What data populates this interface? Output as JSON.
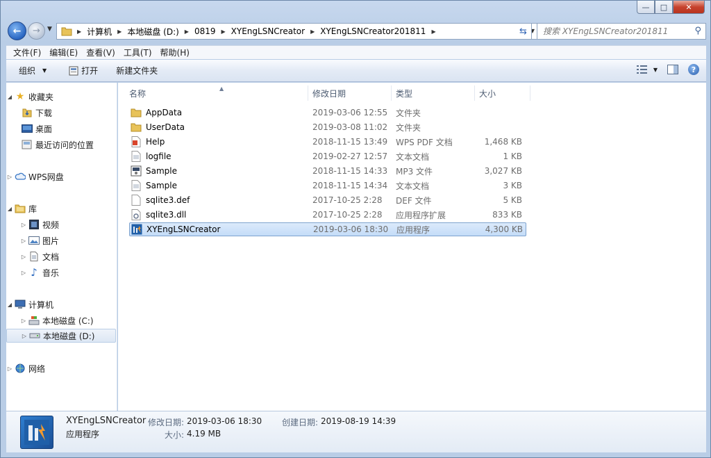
{
  "window": {
    "caption_buttons": {
      "minimize": "—",
      "maximize": "□",
      "close": "✕"
    }
  },
  "address": {
    "crumbs": [
      "计算机",
      "本地磁盘 (D:)",
      "0819",
      "XYEngLSNCreator",
      "XYEngLSNCreator201811"
    ]
  },
  "search": {
    "placeholder": "搜索 XYEngLSNCreator201811"
  },
  "menu": [
    "文件(F)",
    "编辑(E)",
    "查看(V)",
    "工具(T)",
    "帮助(H)"
  ],
  "toolbar": {
    "organize": "组织",
    "open": "打开",
    "new_folder": "新建文件夹"
  },
  "navpane": {
    "favorites": "收藏夹",
    "downloads": "下载",
    "desktop": "桌面",
    "recent": "最近访问的位置",
    "wps": "WPS网盘",
    "libraries": "库",
    "videos": "视频",
    "pictures": "图片",
    "documents": "文档",
    "music": "音乐",
    "computer": "计算机",
    "drive_c": "本地磁盘 (C:)",
    "drive_d": "本地磁盘 (D:)",
    "network": "网络"
  },
  "columns": {
    "name": "名称",
    "date": "修改日期",
    "type": "类型",
    "size": "大小"
  },
  "files": [
    {
      "name": "AppData",
      "date": "2019-03-06 12:55",
      "type": "文件夹",
      "size": "",
      "icon": "folder-icon"
    },
    {
      "name": "UserData",
      "date": "2019-03-08 11:02",
      "type": "文件夹",
      "size": "",
      "icon": "folder-icon"
    },
    {
      "name": "Help",
      "date": "2018-11-15 13:49",
      "type": "WPS PDF 文档",
      "size": "1,468 KB",
      "icon": "pdf-icon"
    },
    {
      "name": "logfile",
      "date": "2019-02-27 12:57",
      "type": "文本文档",
      "size": "1 KB",
      "icon": "text-file-icon"
    },
    {
      "name": "Sample",
      "date": "2018-11-15 14:33",
      "type": "MP3 文件",
      "size": "3,027 KB",
      "icon": "audio-file-icon"
    },
    {
      "name": "Sample",
      "date": "2018-11-15 14:34",
      "type": "文本文档",
      "size": "3 KB",
      "icon": "text-file-icon"
    },
    {
      "name": "sqlite3.def",
      "date": "2017-10-25 2:28",
      "type": "DEF 文件",
      "size": "5 KB",
      "icon": "blank-file-icon"
    },
    {
      "name": "sqlite3.dll",
      "date": "2017-10-25 2:28",
      "type": "应用程序扩展",
      "size": "833 KB",
      "icon": "dll-file-icon"
    },
    {
      "name": "XYEngLSNCreator",
      "date": "2019-03-06 18:30",
      "type": "应用程序",
      "size": "4,300 KB",
      "icon": "app-icon"
    }
  ],
  "details": {
    "name": "XYEngLSNCreator",
    "type": "应用程序",
    "modified_label": "修改日期:",
    "modified": "2019-03-06 18:30",
    "created_label": "创建日期:",
    "created": "2019-08-19 14:39",
    "size_label": "大小:",
    "size": "4.19 MB"
  }
}
